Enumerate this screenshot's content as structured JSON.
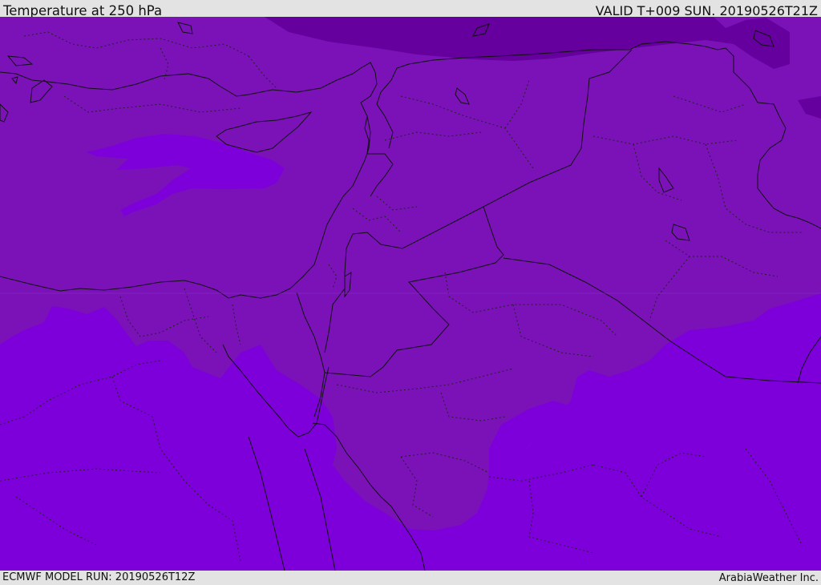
{
  "header": {
    "title": "Temperature at 250 hPa",
    "valid_time": "VALID T+009 SUN. 20190526T21Z"
  },
  "footer": {
    "model_run": "ECMWF MODEL RUN: 20190526T12Z",
    "credit": "ArabiaWeather Inc."
  },
  "colors": {
    "mid_band": "#7a12b8",
    "warm_band": "#7d00db",
    "cold_band": "#65009e",
    "boundary": "#111111",
    "frame": "#e3e3e3"
  }
}
